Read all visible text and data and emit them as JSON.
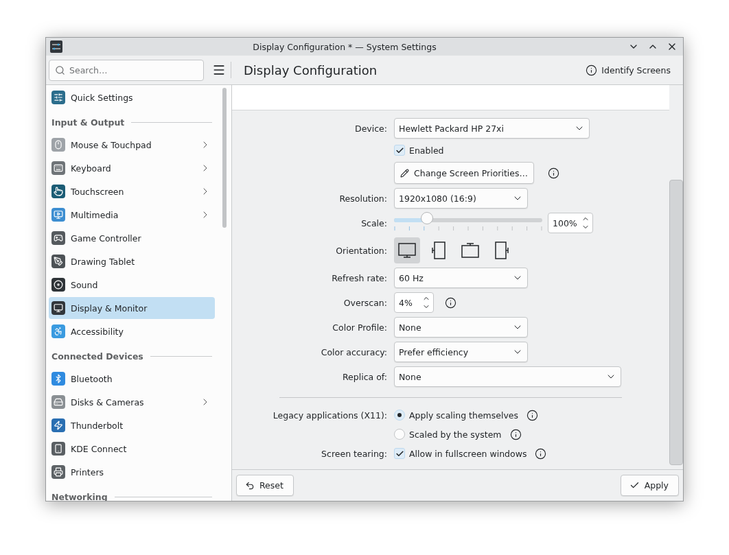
{
  "window": {
    "title": "Display Configuration * — System Settings"
  },
  "search": {
    "placeholder": "Search…"
  },
  "page_title": "Display Configuration",
  "identify_button": "Identify Screens",
  "sidebar": [
    {
      "kind": "item",
      "label": "Quick Settings",
      "chevron": false,
      "selected": false
    },
    {
      "kind": "section",
      "label": "Input & Output"
    },
    {
      "kind": "item",
      "label": "Mouse & Touchpad",
      "chevron": true,
      "selected": false
    },
    {
      "kind": "item",
      "label": "Keyboard",
      "chevron": true,
      "selected": false
    },
    {
      "kind": "item",
      "label": "Touchscreen",
      "chevron": true,
      "selected": false
    },
    {
      "kind": "item",
      "label": "Multimedia",
      "chevron": true,
      "selected": false
    },
    {
      "kind": "item",
      "label": "Game Controller",
      "chevron": false,
      "selected": false
    },
    {
      "kind": "item",
      "label": "Drawing Tablet",
      "chevron": false,
      "selected": false
    },
    {
      "kind": "item",
      "label": "Sound",
      "chevron": false,
      "selected": false
    },
    {
      "kind": "item",
      "label": "Display & Monitor",
      "chevron": false,
      "selected": true
    },
    {
      "kind": "item",
      "label": "Accessibility",
      "chevron": false,
      "selected": false
    },
    {
      "kind": "section",
      "label": "Connected Devices"
    },
    {
      "kind": "item",
      "label": "Bluetooth",
      "chevron": false,
      "selected": false
    },
    {
      "kind": "item",
      "label": "Disks & Cameras",
      "chevron": true,
      "selected": false
    },
    {
      "kind": "item",
      "label": "Thunderbolt",
      "chevron": false,
      "selected": false
    },
    {
      "kind": "item",
      "label": "KDE Connect",
      "chevron": false,
      "selected": false
    },
    {
      "kind": "item",
      "label": "Printers",
      "chevron": false,
      "selected": false
    },
    {
      "kind": "section",
      "label": "Networking"
    }
  ],
  "form": [
    {
      "kind": "select",
      "label": "Device:",
      "value": "Hewlett Packard HP 27xi"
    },
    {
      "kind": "checkbox",
      "text": "Enabled",
      "checked": true
    },
    {
      "kind": "button",
      "text": "Change Screen Priorities…",
      "info": true
    },
    {
      "kind": "select",
      "label": "Resolution:",
      "value": "1920x1080 (16:9)"
    },
    {
      "kind": "slider",
      "label": "Scale:",
      "level": 0.22,
      "reading": "100%"
    },
    {
      "kind": "orientation",
      "label": "Orientation:",
      "options": [
        {
          "selected": true
        },
        {
          "selected": false
        },
        {
          "selected": false
        },
        {
          "selected": false
        }
      ]
    },
    {
      "kind": "select",
      "label": "Refresh rate:",
      "value": "60 Hz"
    },
    {
      "kind": "spinbox",
      "label": "Overscan:",
      "value": "4%",
      "info": true
    },
    {
      "kind": "select",
      "label": "Color Profile:",
      "value": "None"
    },
    {
      "kind": "select",
      "label": "Color accuracy:",
      "value": "Prefer efficiency"
    },
    {
      "kind": "select",
      "label": "Replica of:",
      "value": "None"
    },
    {
      "kind": "separator"
    },
    {
      "kind": "radio",
      "label": "Legacy applications (X11):",
      "text": "Apply scaling themselves",
      "selected": true,
      "info": true
    },
    {
      "kind": "radio",
      "text": "Scaled by the system",
      "selected": false,
      "info": true
    },
    {
      "kind": "checkbox",
      "label": "Screen tearing:",
      "text": "Allow in fullscreen windows",
      "checked": true,
      "info": true
    }
  ],
  "footer": {
    "reset": "Reset",
    "apply": "Apply"
  }
}
